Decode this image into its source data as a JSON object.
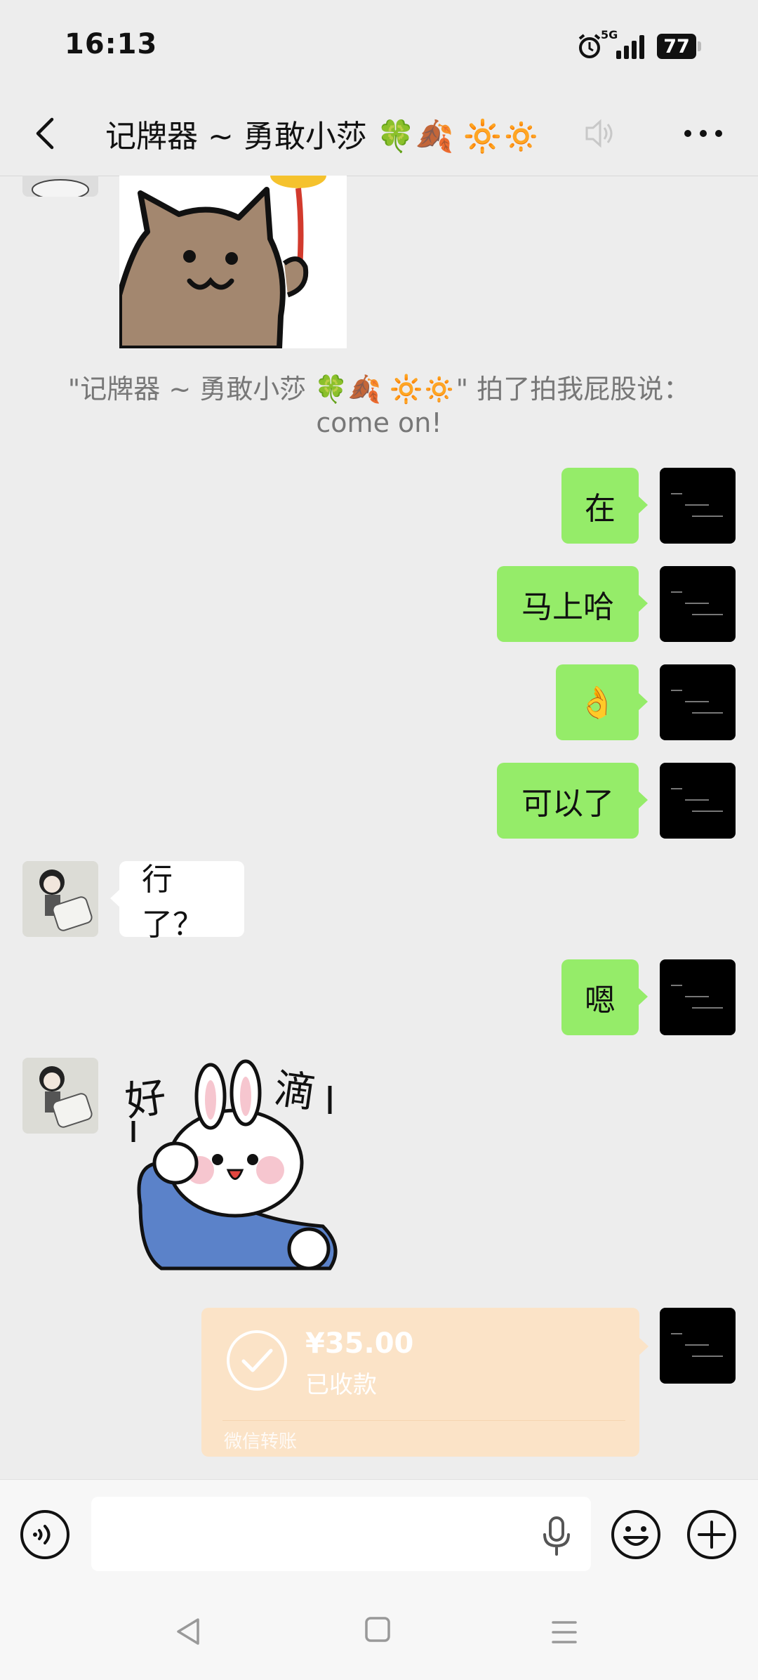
{
  "status_bar": {
    "time": "16:13",
    "network": "5G",
    "battery": "77"
  },
  "nav": {
    "title": "记牌器 ~ 勇敢小莎 🍀🍂 🔆🔅"
  },
  "messages": [
    {
      "type": "sticker",
      "from": "other",
      "description": "cat-with-balloon-sticker"
    },
    {
      "type": "system",
      "text": "\"记牌器 ~ 勇敢小莎 🍀🍂 🔆🔅\" 拍了拍我屁股说：come on!"
    },
    {
      "type": "text",
      "from": "me",
      "text": "在"
    },
    {
      "type": "text",
      "from": "me",
      "text": "马上哈"
    },
    {
      "type": "text",
      "from": "me",
      "text": "👌"
    },
    {
      "type": "text",
      "from": "me",
      "text": "可以了"
    },
    {
      "type": "text",
      "from": "other",
      "text": "行了？"
    },
    {
      "type": "text",
      "from": "me",
      "text": "嗯"
    },
    {
      "type": "sticker",
      "from": "other",
      "text": "好滴"
    },
    {
      "type": "transfer",
      "from": "me",
      "amount": "¥35.00",
      "status": "已收款",
      "source": "微信转账"
    }
  ],
  "input": {
    "placeholder": ""
  },
  "colors": {
    "outgoing_bubble": "#95ec69",
    "incoming_bubble": "#ffffff",
    "transfer_card": "#fbe3c7",
    "background": "#ededed"
  }
}
